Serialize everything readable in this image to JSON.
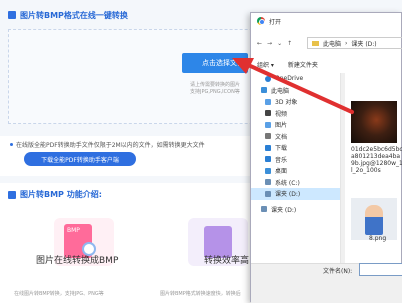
{
  "page": {
    "section_title": "图片转BMP格式在线一键转换",
    "upload_button": "点击选择文件",
    "upload_hint_1": "请上传需要转换的图片",
    "upload_hint_2": "支持JPG,PNG,ICON等",
    "notice_text": "在线版全能PDF转换助手文件仅限于2M以内的文件，如需转换更大文件",
    "download_button": "下载全能PDF转换助手客户端",
    "features_title": "图片转BMP 功能介绍:",
    "feature_1_title": "图片在线转换成BMP",
    "feature_2_title": "转换效率高",
    "feature_1_sub": "在线图片转BMP转换，支持JPG、PNG等",
    "feature_2_sub": "图片转BMP格式转换速度快，转换后",
    "card_1_badge": "BMP"
  },
  "dialog": {
    "title": "打开",
    "path_1": "此电脑",
    "path_2": "课夹 (D:)",
    "organize": "组织 ▾",
    "new_folder": "新建文件夹",
    "nav_items": [
      {
        "label": "OneDrive",
        "icon": "cloud-icon",
        "color": "#2a7fd4"
      },
      {
        "label": "此电脑",
        "icon": "computer-icon",
        "color": "#3b8fd9"
      },
      {
        "label": "3D 对象",
        "icon": "cube-icon",
        "color": "#5aa0e6"
      },
      {
        "label": "视频",
        "icon": "video-icon",
        "color": "#444444"
      },
      {
        "label": "图片",
        "icon": "picture-icon",
        "color": "#5aa0e6"
      },
      {
        "label": "文档",
        "icon": "document-icon",
        "color": "#777777"
      },
      {
        "label": "下载",
        "icon": "download-icon",
        "color": "#2a7fd4"
      },
      {
        "label": "音乐",
        "icon": "music-icon",
        "color": "#2a7fd4"
      },
      {
        "label": "桌面",
        "icon": "desktop-icon",
        "color": "#3b8fd9"
      },
      {
        "label": "系统 (C:)",
        "icon": "drive-icon",
        "color": "#6b8fb5"
      },
      {
        "label": "课夹 (D:)",
        "icon": "drive-icon",
        "color": "#6b8fb5"
      },
      {
        "label": "课夹 (D:)",
        "icon": "drive-icon",
        "color": "#6b8fb5"
      }
    ],
    "file_1": "01dc2e5bc6d5bca801213dea4ba9b.jpg@1280w_1l_2o_100s",
    "file_2": "8.png",
    "file_name_label": "文件名(N):",
    "file_name_value": ""
  },
  "colors": {
    "accent": "#2f6fe0",
    "arrow": "#e03030"
  }
}
